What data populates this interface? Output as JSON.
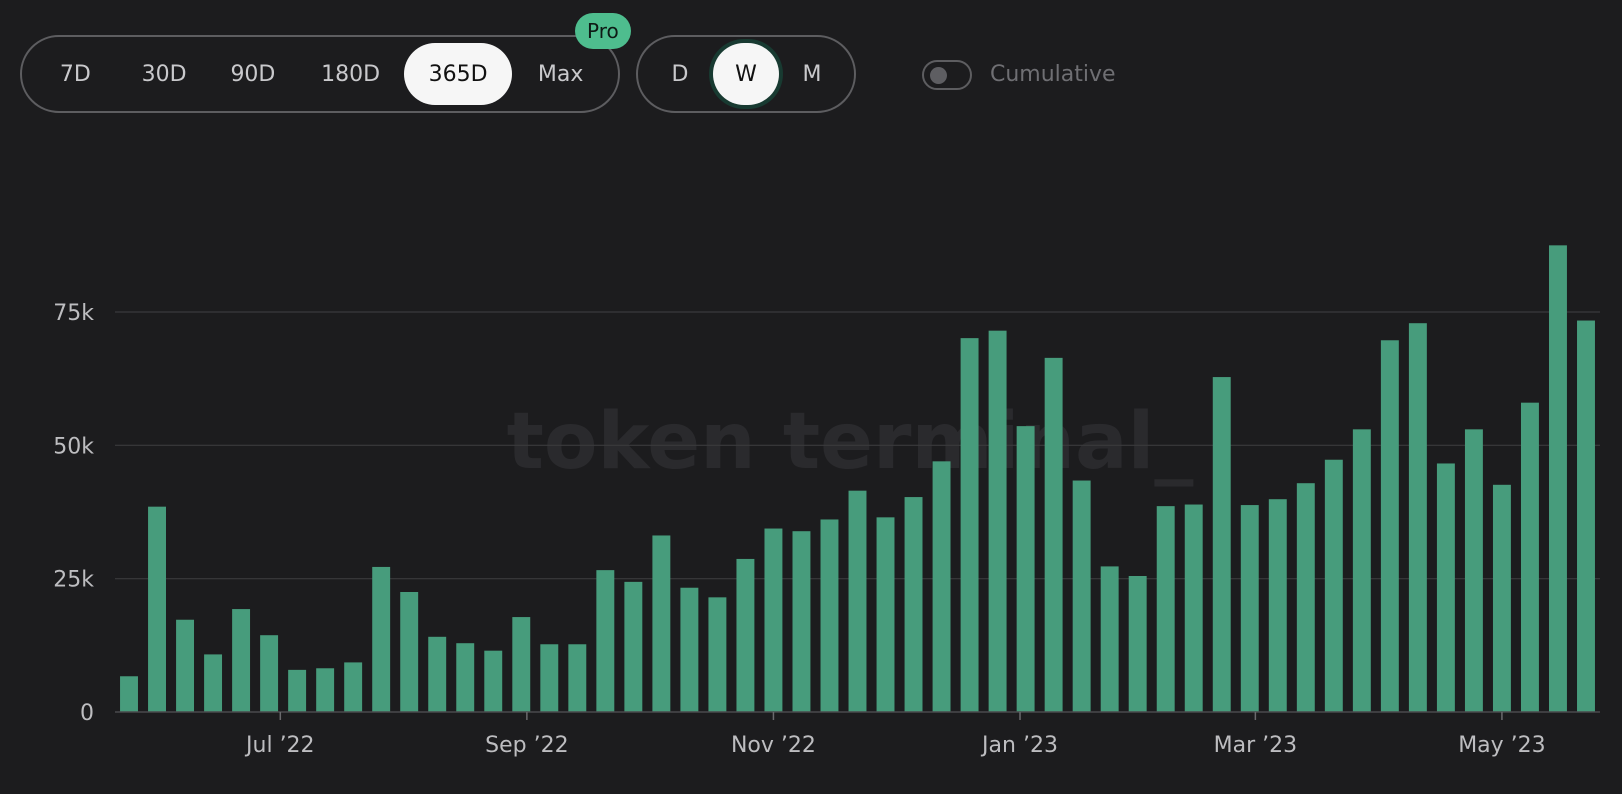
{
  "controls": {
    "ranges": [
      {
        "label": "7D",
        "active": false
      },
      {
        "label": "30D",
        "active": false
      },
      {
        "label": "90D",
        "active": false
      },
      {
        "label": "180D",
        "active": false
      },
      {
        "label": "365D",
        "active": true
      },
      {
        "label": "Max",
        "active": false
      }
    ],
    "pro_badge": "Pro",
    "intervals": [
      {
        "label": "D",
        "active": false
      },
      {
        "label": "W",
        "active": true
      },
      {
        "label": "M",
        "active": false
      }
    ],
    "cumulative": {
      "label": "Cumulative",
      "enabled": false
    }
  },
  "watermark": "token terminal_",
  "colors": {
    "bar": "#479c7c",
    "accent": "#4ebd8e",
    "background": "#1c1c1e"
  },
  "chart_data": {
    "type": "bar",
    "ylim": [
      0,
      90000
    ],
    "y_ticks": [
      {
        "value": 0,
        "label": "0"
      },
      {
        "value": 25000,
        "label": "25k"
      },
      {
        "value": 50000,
        "label": "50k"
      },
      {
        "value": 75000,
        "label": "75k"
      }
    ],
    "grid": true,
    "x_ticks": [
      {
        "index": 5.9,
        "label": "Jul ’22"
      },
      {
        "index": 14.7,
        "label": "Sep ’22"
      },
      {
        "index": 23.5,
        "label": "Nov ’22"
      },
      {
        "index": 32.3,
        "label": "Jan ’23"
      },
      {
        "index": 40.7,
        "label": "Mar ’23"
      },
      {
        "index": 49.5,
        "label": "May ’23"
      }
    ],
    "values": [
      6700,
      38500,
      17300,
      10800,
      19300,
      14400,
      7900,
      8200,
      9300,
      27200,
      22500,
      14100,
      12900,
      11500,
      17800,
      12700,
      12700,
      26600,
      24400,
      33100,
      23300,
      21500,
      28700,
      34400,
      33900,
      36100,
      41500,
      36500,
      40300,
      47000,
      70100,
      71500,
      53600,
      66400,
      43400,
      27300,
      25500,
      38600,
      38900,
      62800,
      38800,
      39900,
      42900,
      47300,
      53000,
      69700,
      72900,
      46600,
      53000,
      42600,
      58000,
      87500,
      73400
    ]
  }
}
